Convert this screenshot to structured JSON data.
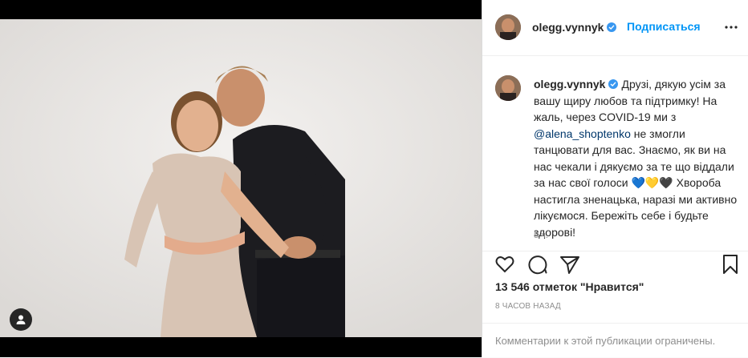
{
  "post": {
    "username": "olegg.vynnyk",
    "follow_label": "Подписаться",
    "caption_part1": "Друзі, дякую усім за вашу щиру любов та підтримку! На жаль, через COVID-19 ми з ",
    "mention": "@alena_shoptenko",
    "caption_part2": " не змогли танцювати для вас. Знаємо, як ви на нас чекали і дякуємо за те що віддали за нас свої голоси ",
    "hearts": [
      "💙",
      "💛",
      "🖤"
    ],
    "caption_part3": " Хвороба настигла зненацька, наразі ми активно лікуємося. Бережіть себе і будьте здорові!",
    "time_short": "8 ч.",
    "likes": "13 546 отметок \"Нравится\"",
    "time_ago": "8 ЧАСОВ НАЗАД",
    "comments_disabled": "Комментарии к этой публикации ограничены.",
    "colors": {
      "accent": "#0095f6",
      "verified": "#3897f0",
      "text": "#262626",
      "muted": "#8e8e8e"
    },
    "icons": [
      "verified-badge-icon",
      "more-options-icon",
      "like-heart-icon",
      "comment-icon",
      "share-icon",
      "save-icon",
      "user-tag-icon"
    ]
  }
}
